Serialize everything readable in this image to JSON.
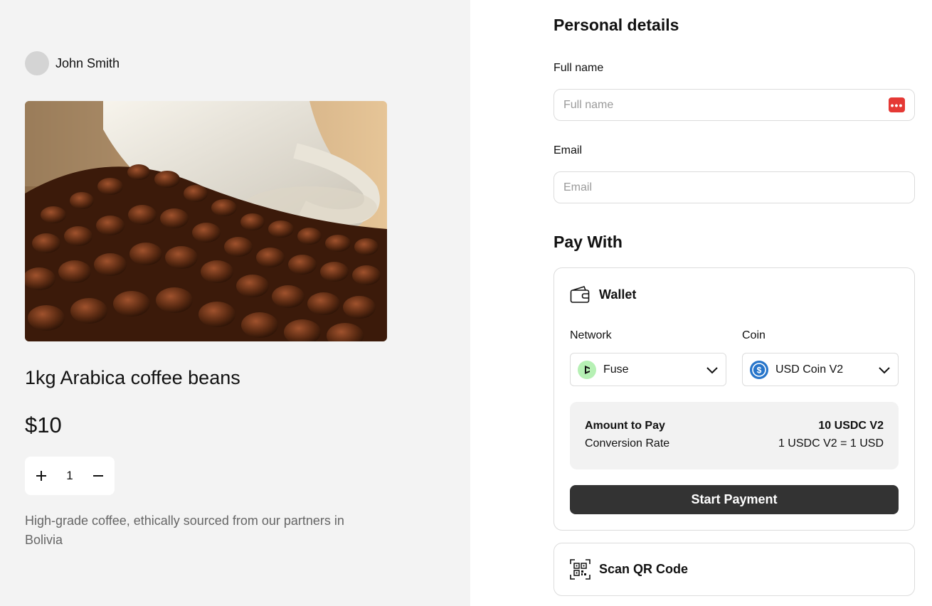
{
  "merchant": {
    "name": "John Smith"
  },
  "product": {
    "title": "1kg Arabica coffee beans",
    "price": "$10",
    "quantity": "1",
    "description": "High-grade coffee, ethically sourced from our partners in Bolivia"
  },
  "personal": {
    "heading": "Personal details",
    "full_name_label": "Full name",
    "full_name_placeholder": "Full name",
    "full_name_value": "",
    "email_label": "Email",
    "email_placeholder": "Email",
    "email_value": ""
  },
  "pay": {
    "heading": "Pay With",
    "wallet": {
      "title": "Wallet",
      "network_label": "Network",
      "network_value": "Fuse",
      "coin_label": "Coin",
      "coin_value": "USD Coin V2",
      "amount_label": "Amount to Pay",
      "amount_value": "10 USDC V2",
      "rate_label": "Conversion Rate",
      "rate_value": "1 USDC V2 = 1 USD",
      "button": "Start Payment"
    },
    "qr": {
      "title": "Scan QR Code"
    }
  },
  "colors": {
    "left_bg": "#f3f3f3",
    "button_bg": "#333333",
    "fuse_icon": "#b6f0b4",
    "usdc_icon": "#2775ca",
    "password_manager_icon": "#e53935"
  }
}
